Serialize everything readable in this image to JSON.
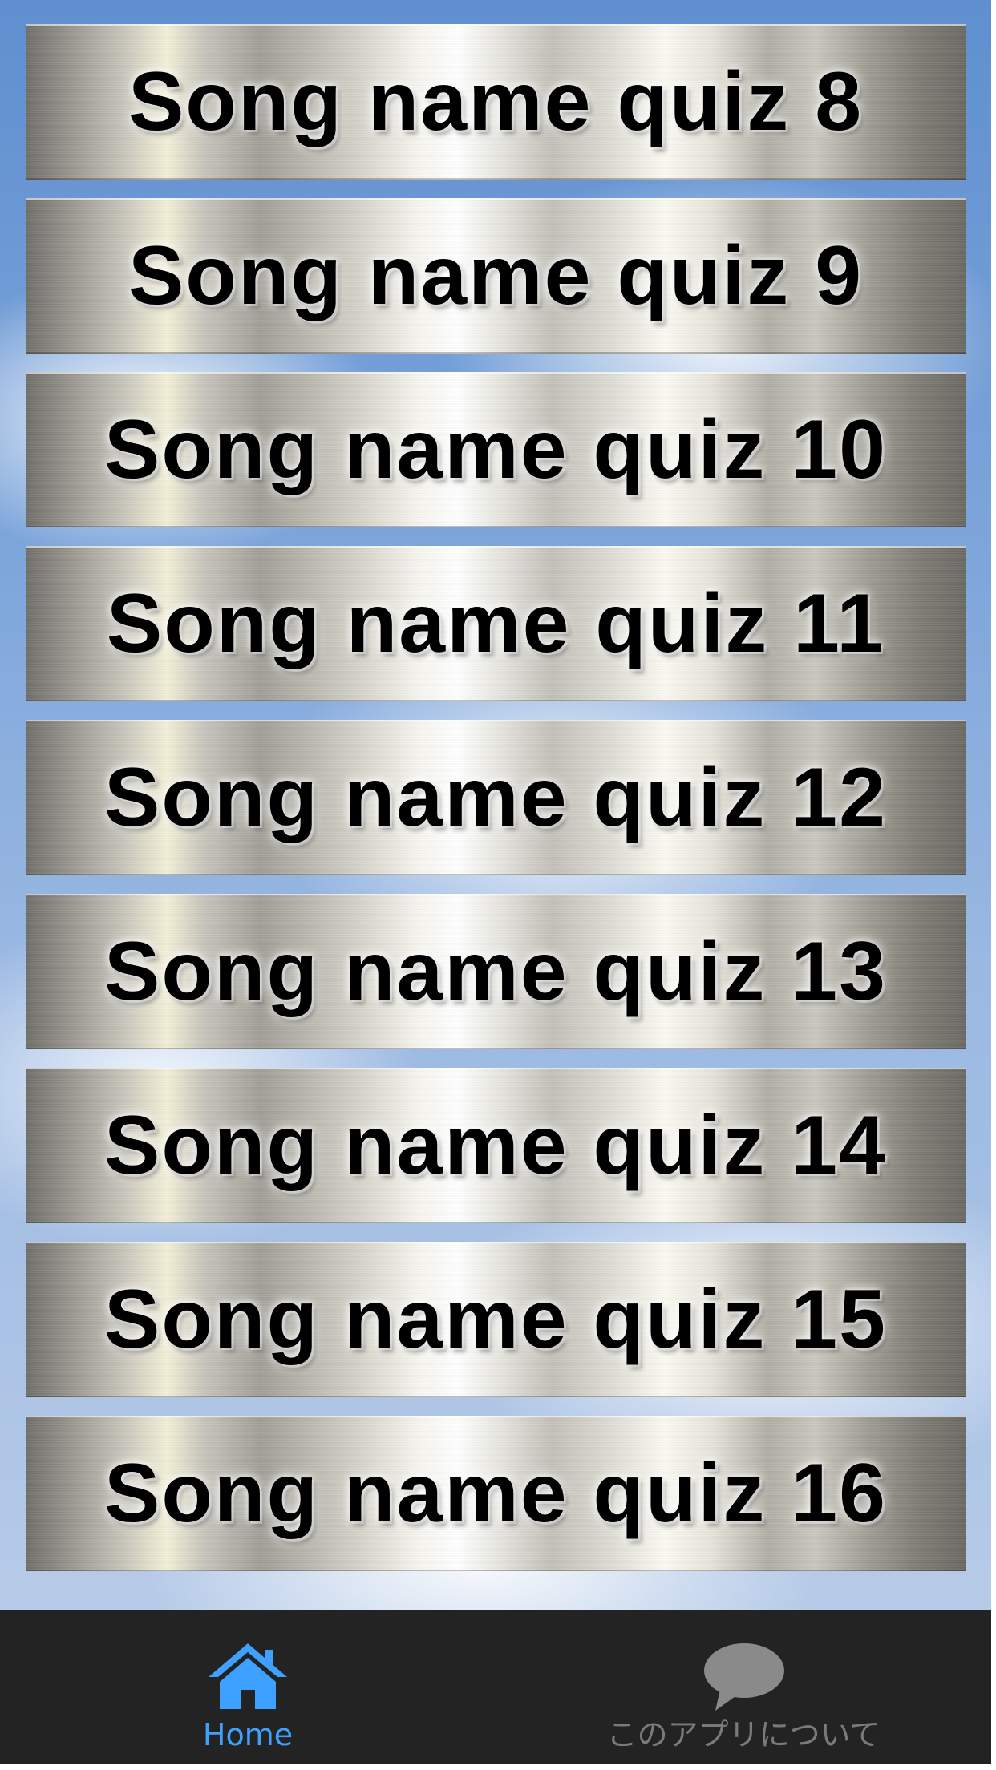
{
  "quiz_list": {
    "items": [
      {
        "label": "Song name quiz 8"
      },
      {
        "label": "Song name quiz 9"
      },
      {
        "label": "Song name quiz 10"
      },
      {
        "label": "Song name quiz 11"
      },
      {
        "label": "Song name quiz 12"
      },
      {
        "label": "Song name quiz 13"
      },
      {
        "label": "Song name quiz 14"
      },
      {
        "label": "Song name quiz 15"
      },
      {
        "label": "Song name quiz 16"
      }
    ]
  },
  "tabbar": {
    "home": {
      "label": "Home",
      "icon": "home-icon",
      "active": true,
      "color": "#3ea0ff"
    },
    "about": {
      "label": "このアプリについて",
      "icon": "speech-bubble-icon",
      "active": false,
      "color": "#7a7a7a"
    },
    "background": "#232323"
  }
}
